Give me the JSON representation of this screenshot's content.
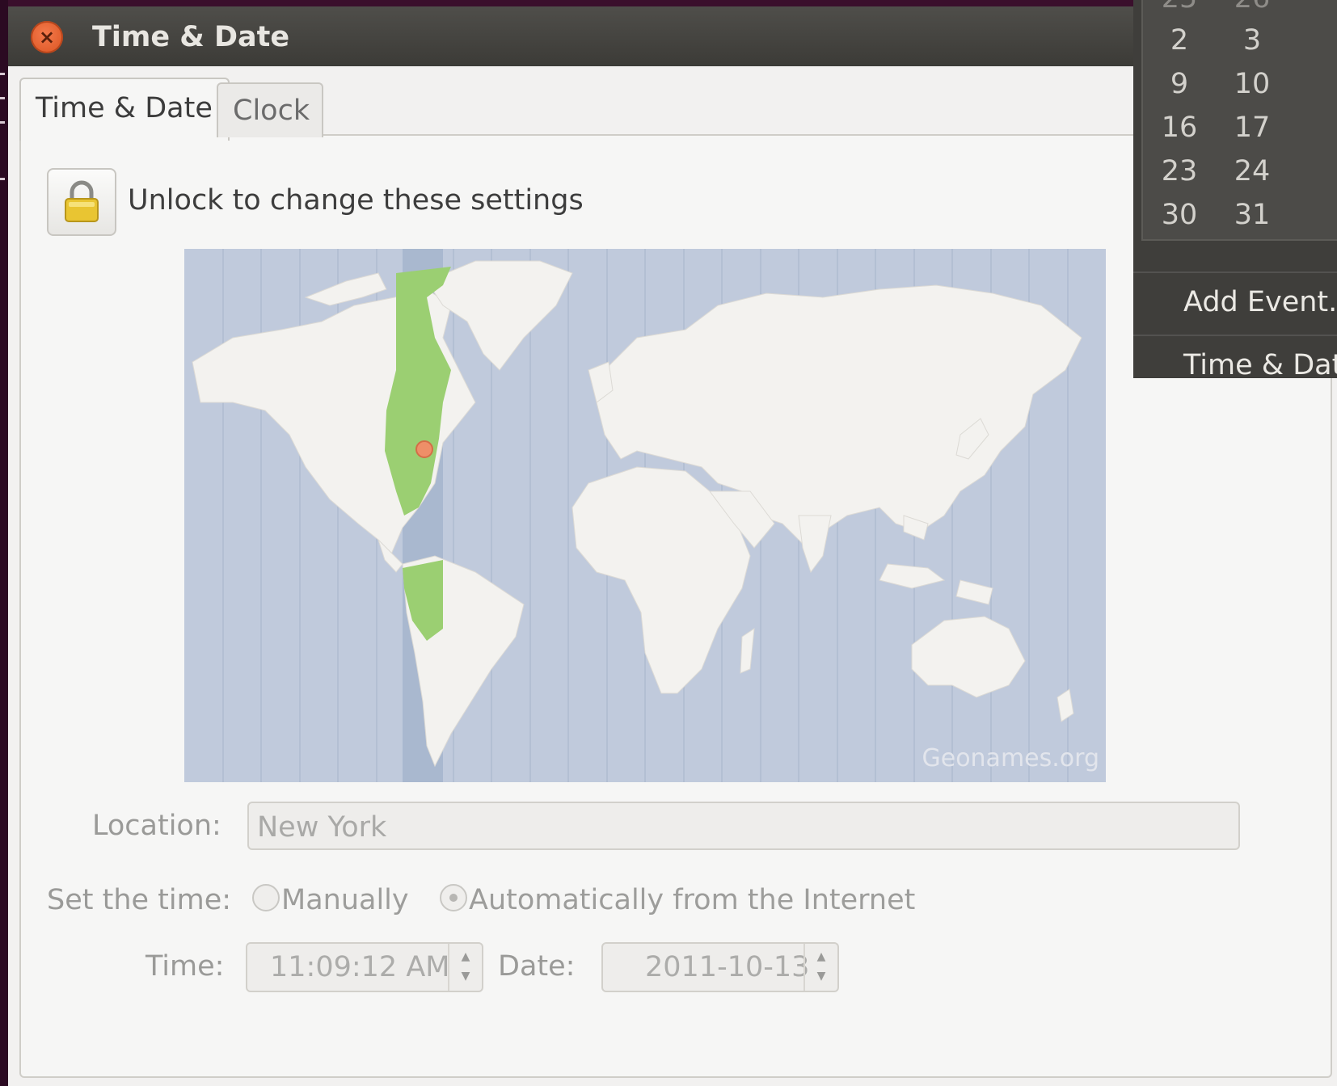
{
  "window": {
    "title": "Time & Date",
    "close_symbol": "×"
  },
  "tabs": [
    {
      "label": "Time & Date",
      "active": true
    },
    {
      "label": "Clock",
      "active": false
    }
  ],
  "lock": {
    "label": "Unlock to change these settings",
    "icon": "lock-icon"
  },
  "map": {
    "attribution": "Geonames.org",
    "highlighted_timezone_color": "#9bcf72",
    "ocean_color": "#c0cadc",
    "land_color": "#f3f2ef",
    "marker_color": "#ee8f68"
  },
  "form": {
    "location_label": "Location:",
    "location_value": "New York",
    "set_time_label": "Set the time:",
    "manual_label": "Manually",
    "auto_label": "Automatically from the Internet",
    "selected_mode": "auto",
    "time_label": "Time:",
    "time_value": "11:09:12 AM",
    "date_label": "Date:",
    "date_value": "2011-10-13"
  },
  "calendar_menu": {
    "partial_top_row": [
      "25",
      "26"
    ],
    "days": [
      "2",
      "3",
      "9",
      "10",
      "16",
      "17",
      "23",
      "24",
      "30",
      "31"
    ],
    "items": [
      "Add Event.",
      "Time & Dat"
    ]
  }
}
